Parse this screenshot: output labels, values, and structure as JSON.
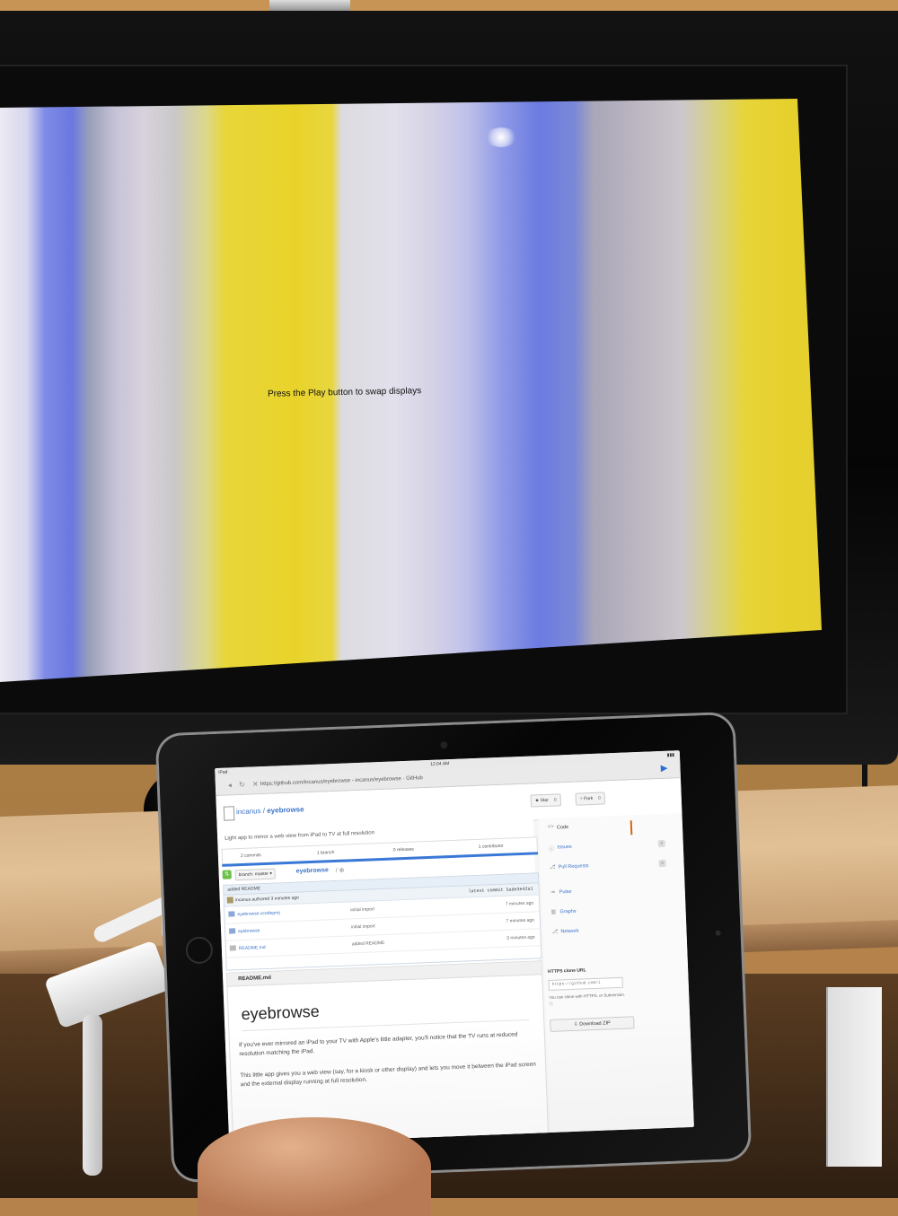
{
  "tv": {
    "message": "Press the Play button to swap displays"
  },
  "ipad": {
    "status": {
      "carrier": "iPad",
      "time": "12:04 AM"
    },
    "browser": {
      "nav_symbols": "◂ ↻ ✕",
      "url": "https://github.com/incanus/eyebrowse - incanus/eyebrowse · GitHub",
      "play": "▶"
    },
    "repo": {
      "owner": "incanus",
      "separator": " / ",
      "name": "eyebrowse",
      "star_label": "★ Star",
      "star_count": "0",
      "fork_label": "Fork",
      "fork_count": "0",
      "description": "Light app to mirror a web view from iPad to TV at full resolution"
    },
    "stats": {
      "commits": "2 commits",
      "branch": "1 branch",
      "releases": "0 releases",
      "contributor": "1 contributor"
    },
    "branch": {
      "sync": "⇅",
      "selector": "branch: master ▾",
      "crumb": "eyebrowse",
      "crumb_sep": "/ ⊕"
    },
    "commit": {
      "message": "added README",
      "author": "incanus authored 3 minutes ago",
      "latest": "latest commit 5ade3e42a1"
    },
    "files": [
      {
        "name": "eyebrowse.xcodeproj",
        "msg": "initial import",
        "age": "7 minutes ago"
      },
      {
        "name": "eyebrowse",
        "msg": "initial import",
        "age": "7 minutes ago"
      },
      {
        "name": "README.md",
        "msg": "added README",
        "age": "3 minutes ago"
      }
    ],
    "readme": {
      "header": "README.md",
      "title": "eyebrowse",
      "p1": "If you've ever mirrored an iPad to your TV with Apple's little adapter, you'll notice that the TV runs at reduced resolution matching the iPad.",
      "p2": "This little app gives you a web view (say, for a kiosk or other display) and lets you move it between the iPad screen and the external display running at full resolution."
    },
    "sidebar": {
      "items": [
        {
          "icon": "<>",
          "label": "Code",
          "count": ""
        },
        {
          "icon": "ⓘ",
          "label": "Issues",
          "count": "0"
        },
        {
          "icon": "⎇",
          "label": "Pull Requests",
          "count": "0"
        },
        {
          "icon": "⇥",
          "label": "Pulse",
          "count": ""
        },
        {
          "icon": "▥",
          "label": "Graphs",
          "count": ""
        },
        {
          "icon": "⎇",
          "label": "Network",
          "count": ""
        }
      ],
      "clone_label": "HTTPS clone URL",
      "clone_value": "https://github.com/i",
      "clone_help": "You can clone with HTTPS, or Subversion. ⓘ",
      "zip_label": "⇩ Download ZIP"
    }
  }
}
